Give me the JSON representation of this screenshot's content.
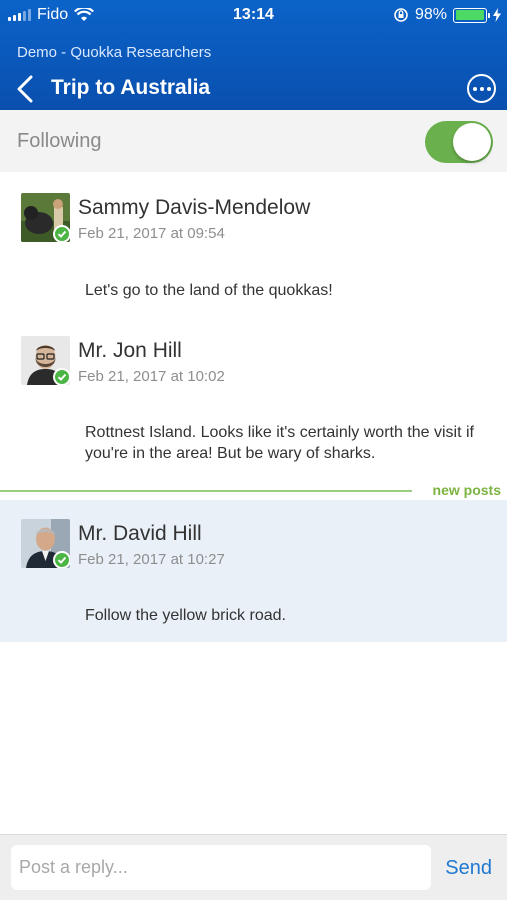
{
  "status_bar": {
    "carrier": "Fido",
    "time": "13:14",
    "battery_percent": "98%",
    "battery_level": 0.98
  },
  "nav": {
    "subtitle": "Demo - Quokka Researchers",
    "title": "Trip to Australia",
    "back_icon": "chevron-left-icon",
    "more_icon": "ellipsis-circle-icon"
  },
  "following": {
    "label": "Following",
    "enabled": true,
    "accent": "#6ab04c"
  },
  "posts": [
    {
      "author": "Sammy Davis-Mendelow",
      "date": "Feb 21, 2017 at 09:54",
      "body": "Let's go to the land of the quokkas!",
      "verified": true
    },
    {
      "author": "Mr. Jon Hill",
      "date": "Feb 21, 2017 at 10:02",
      "body": "Rottnest Island. Looks like it's certainly worth the visit if you're in the area! But be wary of sharks.",
      "verified": true
    },
    {
      "author": "Mr. David Hill",
      "date": "Feb 21, 2017 at 10:27",
      "body": "Follow the yellow brick road.",
      "verified": true,
      "new": true
    }
  ],
  "new_posts_label": "new posts",
  "reply": {
    "placeholder": "Post a reply...",
    "value": "",
    "send_label": "Send"
  },
  "colors": {
    "header": "#0a56b8",
    "new_posts": "#7cb342",
    "highlight": "#e9f0f7",
    "send": "#1f78d1"
  }
}
